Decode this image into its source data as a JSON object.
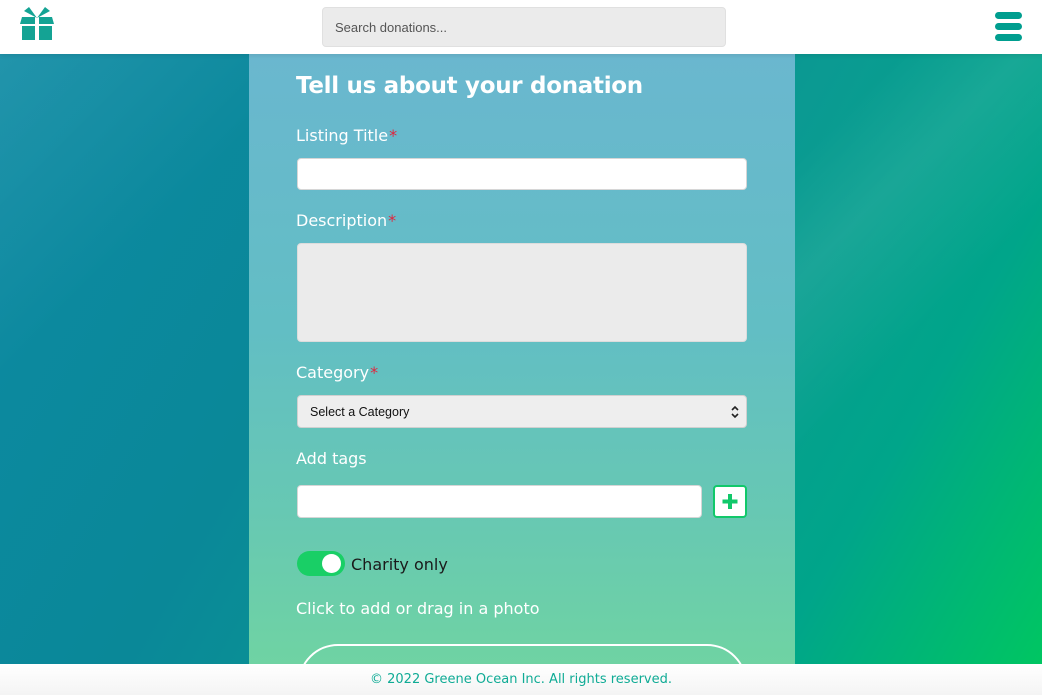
{
  "header": {
    "search_placeholder": "Search donations...",
    "logo_icon": "gift-box-icon",
    "menu_icon": "hamburger-menu-icon",
    "accent_color": "#009e8f"
  },
  "form": {
    "title": "Tell us about your donation",
    "listing_title_label": "Listing Title",
    "description_label": "Description",
    "category_label": "Category",
    "required_mark": "*",
    "category_selected": "Select a Category",
    "tags_label": "Add tags",
    "add_tag_icon": "plus-icon",
    "charity_only_label": "Charity only",
    "charity_only_enabled": true,
    "photo_hint": "Click to add or drag in a photo"
  },
  "footer": {
    "copyright": "© 2022 Greene Ocean Inc. All rights reserved."
  },
  "colors": {
    "required": "#e0243c",
    "toggle_on": "#19cf66",
    "footer_text": "#0fab95"
  }
}
